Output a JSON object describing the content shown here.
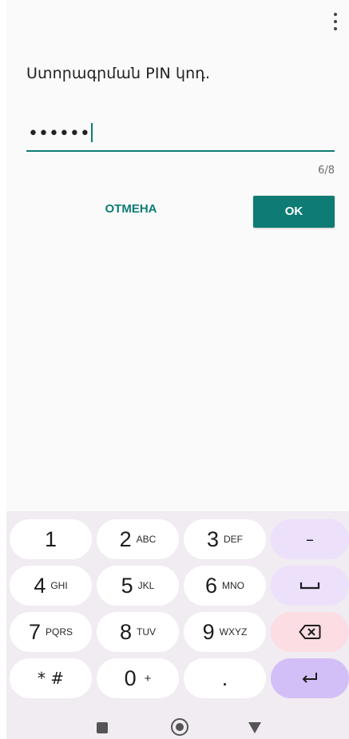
{
  "dialog": {
    "title": "Ստորագրման PIN կոդ.",
    "pin_masked": "••••••",
    "counter": "6/8",
    "cancel_label": "ОТМЕНА",
    "ok_label": "OK",
    "accent_color": "#0e7c74"
  },
  "keyboard": {
    "row1": [
      {
        "num": "1",
        "letters": ""
      },
      {
        "num": "2",
        "letters": "ABC"
      },
      {
        "num": "3",
        "letters": "DEF"
      }
    ],
    "row2": [
      {
        "num": "4",
        "letters": "GHI"
      },
      {
        "num": "5",
        "letters": "JKL"
      },
      {
        "num": "6",
        "letters": "MNO"
      }
    ],
    "row3": [
      {
        "num": "7",
        "letters": "PQRS"
      },
      {
        "num": "8",
        "letters": "TUV"
      },
      {
        "num": "9",
        "letters": "WXYZ"
      }
    ],
    "row4": [
      {
        "num": "* #",
        "letters": ""
      },
      {
        "num": "0",
        "letters": "+"
      },
      {
        "num": ".",
        "letters": ""
      }
    ],
    "minus_label": "–",
    "space_icon": "space-bar-icon",
    "backspace_icon": "backspace-icon",
    "enter_icon": "enter-icon"
  },
  "navbar": {
    "icons": [
      "recent-apps-icon",
      "home-icon",
      "back-icon"
    ]
  }
}
